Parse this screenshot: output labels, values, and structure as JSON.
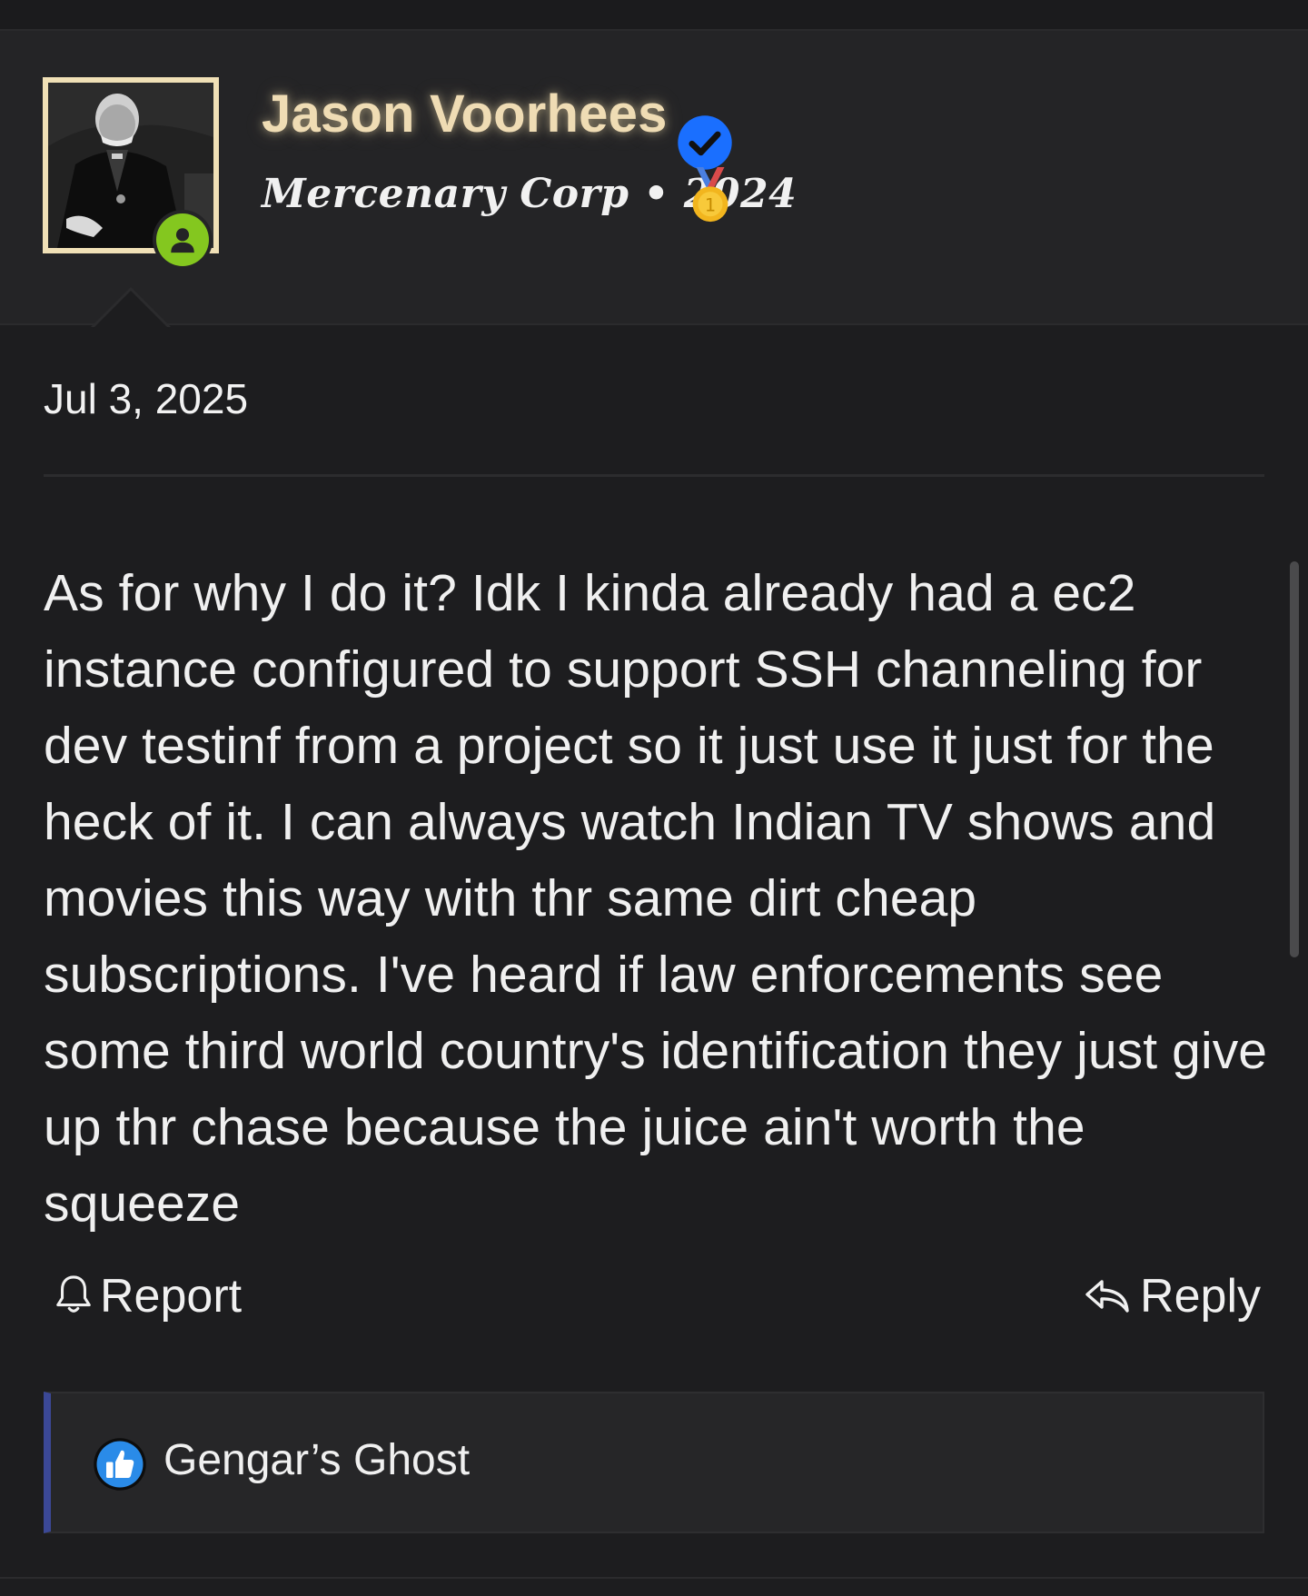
{
  "user": {
    "name": "Jason Voorhees",
    "title_line": "Mercenary Corp • 2024",
    "verified_color": "#1a6fff",
    "online_status_color": "#84c71f",
    "name_color": "#efdcb4",
    "avatar_border_color": "#f0e0b6",
    "icons": [
      "verified-check-icon",
      "gold-medal-icon",
      "online-user-icon"
    ]
  },
  "post": {
    "date": "Jul 3, 2025",
    "body": "As for why I do it? Idk I kinda already had a ec2 instance configured to support SSH channeling for dev testinf from a project so it just use it just for the heck of it. I can always watch Indian TV shows and movies this way with thr same dirt cheap subscriptions. I've heard if law enforcements see some third world country's identification they just give up thr chase because the juice ain't worth the squeeze"
  },
  "actions": {
    "report_label": "Report",
    "reply_label": "Reply",
    "icons": [
      "bell-icon",
      "reply-arrow-icon"
    ]
  },
  "reactions": {
    "accent_color": "#3b4896",
    "reaction_icon": "thumbs-up-icon",
    "reactor": "Gengar’s Ghost"
  }
}
